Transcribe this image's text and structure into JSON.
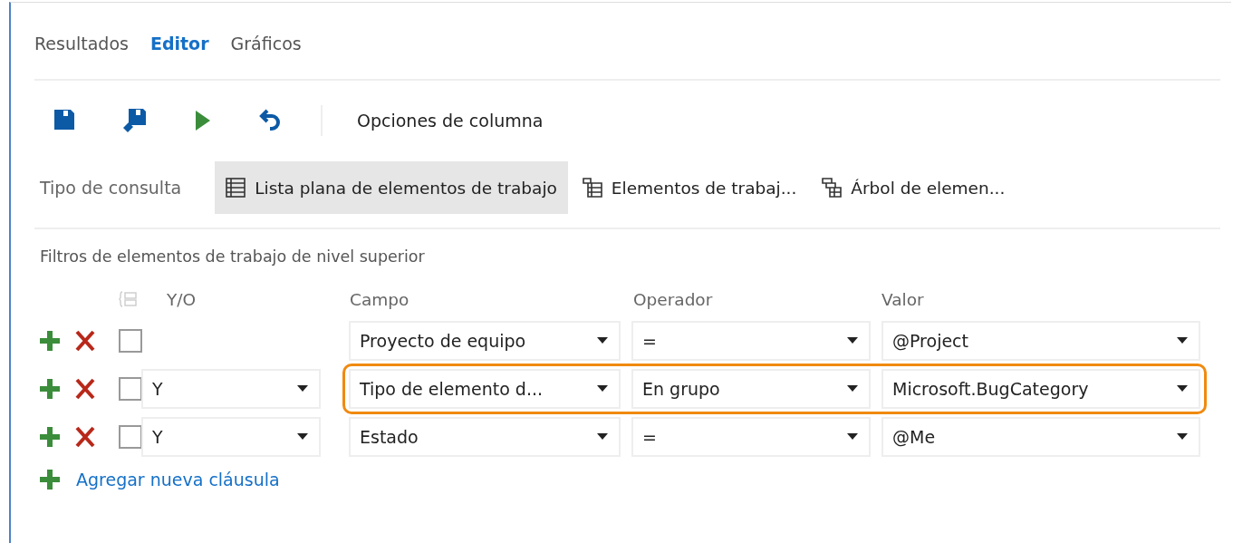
{
  "tabs": [
    {
      "label": "Resultados",
      "selected": false
    },
    {
      "label": "Editor",
      "selected": true
    },
    {
      "label": "Gráficos",
      "selected": false
    }
  ],
  "toolbar": {
    "buttons": [
      {
        "kind": "save"
      },
      {
        "kind": "save-as"
      },
      {
        "kind": "run"
      },
      {
        "kind": "undo"
      }
    ],
    "column_options": "Opciones de columna"
  },
  "query_type": {
    "label": "Tipo de consulta",
    "options": [
      {
        "label": "Lista plana de elementos de trabajo",
        "kind": "flat",
        "selected": true
      },
      {
        "label": "Elementos de trabaj...",
        "kind": "direct",
        "selected": false
      },
      {
        "label": "Árbol de elemen...",
        "kind": "tree",
        "selected": false
      }
    ]
  },
  "filters": {
    "title": "Filtros de elementos de trabajo de nivel superior",
    "columns": {
      "and_or": "Y/O",
      "field": "Campo",
      "operator": "Operador",
      "value": "Valor"
    },
    "clauses": [
      {
        "checked": false,
        "field": "Proyecto de equipo",
        "operator": "=",
        "value": "@Project",
        "highlighted": false
      },
      {
        "checked": false,
        "and_or": "Y",
        "field": "Tipo de elemento d...",
        "operator": "En grupo",
        "value": "Microsoft.BugCategory",
        "highlighted": true
      },
      {
        "checked": false,
        "and_or": "Y",
        "field": "Estado",
        "operator": "=",
        "value": "@Me",
        "highlighted": false
      }
    ],
    "add_clause": "Agregar nueva cláusula"
  }
}
